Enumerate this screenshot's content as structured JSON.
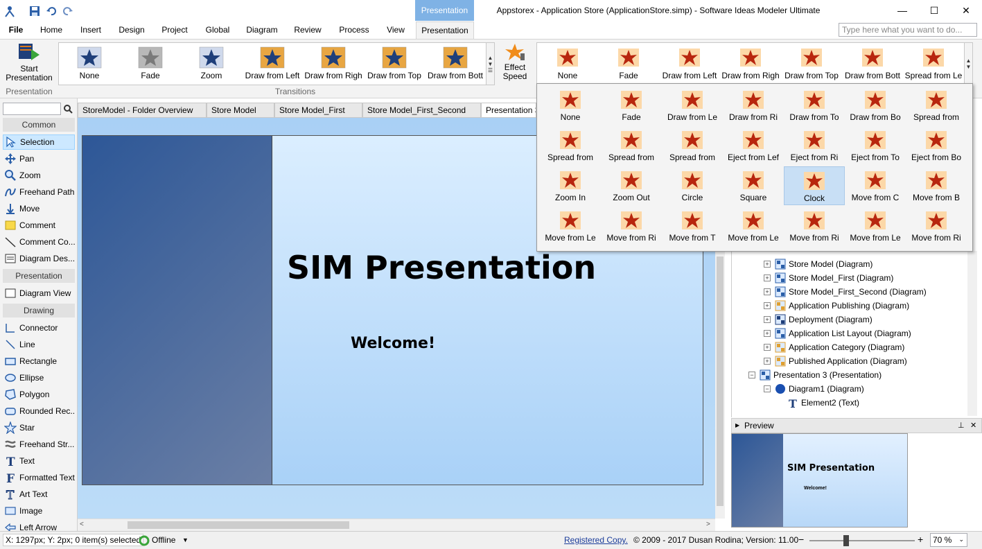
{
  "window": {
    "title": "Appstorex - Application Store (ApplicationStore.simp) - Software Ideas Modeler Ultimate",
    "context_tab_header": "Presentation",
    "minimize": "—",
    "maximize": "☐",
    "close": "✕"
  },
  "ribbon_tabs": [
    {
      "label": "File"
    },
    {
      "label": "Home"
    },
    {
      "label": "Insert"
    },
    {
      "label": "Design"
    },
    {
      "label": "Project"
    },
    {
      "label": "Global"
    },
    {
      "label": "Diagram"
    },
    {
      "label": "Review"
    },
    {
      "label": "Process"
    },
    {
      "label": "View"
    },
    {
      "label": "Presentation"
    }
  ],
  "search_placeholder": "Type here what you want to do...",
  "ribbon": {
    "start_presentation": "Start Presentation",
    "presentation_group": "Presentation",
    "transitions_group": "Transitions",
    "effect_speed": "Effect Speed",
    "transitions": [
      {
        "label": "None"
      },
      {
        "label": "Fade"
      },
      {
        "label": "Zoom"
      },
      {
        "label": "Draw from Left"
      },
      {
        "label": "Draw from Righ"
      },
      {
        "label": "Draw from Top"
      },
      {
        "label": "Draw from Bott"
      }
    ],
    "effects": [
      {
        "label": "None"
      },
      {
        "label": "Fade"
      },
      {
        "label": "Draw from Left"
      },
      {
        "label": "Draw from Righ"
      },
      {
        "label": "Draw from Top"
      },
      {
        "label": "Draw from Bott"
      },
      {
        "label": "Spread from Le"
      }
    ]
  },
  "effects_dropdown": [
    {
      "label": "None"
    },
    {
      "label": "Fade"
    },
    {
      "label": "Draw  from Le"
    },
    {
      "label": "Draw  from Ri"
    },
    {
      "label": "Draw  from To"
    },
    {
      "label": "Draw  from Bo"
    },
    {
      "label": "Spread from"
    },
    {
      "label": "Spread from"
    },
    {
      "label": "Spread from"
    },
    {
      "label": "Spread from"
    },
    {
      "label": "Eject from Lef"
    },
    {
      "label": "Eject from Ri"
    },
    {
      "label": "Eject from To"
    },
    {
      "label": "Eject from Bo"
    },
    {
      "label": "Zoom In"
    },
    {
      "label": "Zoom Out"
    },
    {
      "label": "Circle"
    },
    {
      "label": "Square"
    },
    {
      "label": "Clock"
    },
    {
      "label": "Move from C"
    },
    {
      "label": "Move from B"
    },
    {
      "label": "Move from Le"
    },
    {
      "label": "Move from Ri"
    },
    {
      "label": "Move from T"
    },
    {
      "label": "Move from Le"
    },
    {
      "label": "Move from Ri"
    },
    {
      "label": "Move from Le"
    },
    {
      "label": "Move from Ri"
    }
  ],
  "toolbox": {
    "sections": {
      "common": "Common",
      "presentation": "Presentation",
      "drawing": "Drawing"
    },
    "common": [
      {
        "label": "Selection"
      },
      {
        "label": "Pan"
      },
      {
        "label": "Zoom"
      },
      {
        "label": "Freehand Path"
      },
      {
        "label": "Move"
      },
      {
        "label": "Comment"
      },
      {
        "label": "Comment Co..."
      },
      {
        "label": "Diagram Des..."
      }
    ],
    "presentation": [
      {
        "label": "Diagram View"
      }
    ],
    "drawing": [
      {
        "label": "Connector"
      },
      {
        "label": "Line"
      },
      {
        "label": "Rectangle"
      },
      {
        "label": "Ellipse"
      },
      {
        "label": "Polygon"
      },
      {
        "label": "Rounded Rec..."
      },
      {
        "label": "Star"
      },
      {
        "label": "Freehand Str..."
      },
      {
        "label": "Text"
      },
      {
        "label": "Formatted Text"
      },
      {
        "label": "Art Text"
      },
      {
        "label": "Image"
      },
      {
        "label": "Left Arrow"
      }
    ]
  },
  "doc_tabs": [
    {
      "label": "StoreModel - Folder Overview"
    },
    {
      "label": "Store Model"
    },
    {
      "label": "Store Model_First"
    },
    {
      "label": "Store Model_First_Second"
    },
    {
      "label": "Presentation 3"
    }
  ],
  "slide": {
    "title": "SIM Presentation",
    "subtitle": "Welcome!"
  },
  "tree": [
    {
      "label": "Store Model (Diagram)"
    },
    {
      "label": "Store Model_First (Diagram)"
    },
    {
      "label": "Store Model_First_Second (Diagram)"
    },
    {
      "label": "Application Publishing (Diagram)"
    },
    {
      "label": "Deployment (Diagram)"
    },
    {
      "label": "Application List Layout (Diagram)"
    },
    {
      "label": "Application Category (Diagram)"
    },
    {
      "label": "Published Application (Diagram)"
    },
    {
      "label": "Presentation 3 (Presentation)"
    },
    {
      "label": "Diagram1 (Diagram)"
    },
    {
      "label": "Element2 (Text)"
    }
  ],
  "preview": {
    "header": "Preview",
    "title": "SIM Presentation",
    "subtitle": "Welcome!"
  },
  "status": {
    "coords": "X: 1297px; Y: 2px; 0 item(s) selected",
    "online": "Offline",
    "registered": "Registered Copy.",
    "copyright": "© 2009 - 2017 Dusan Rodina; Version: 11.00",
    "zoom": "70 %"
  },
  "colors": {
    "accent": "#7fb2e5",
    "slide_dark": "#2d5797",
    "effect_red": "#b8260e",
    "effect_bg": "#fcd8a8",
    "transition_blue": "#1f3f7a"
  }
}
